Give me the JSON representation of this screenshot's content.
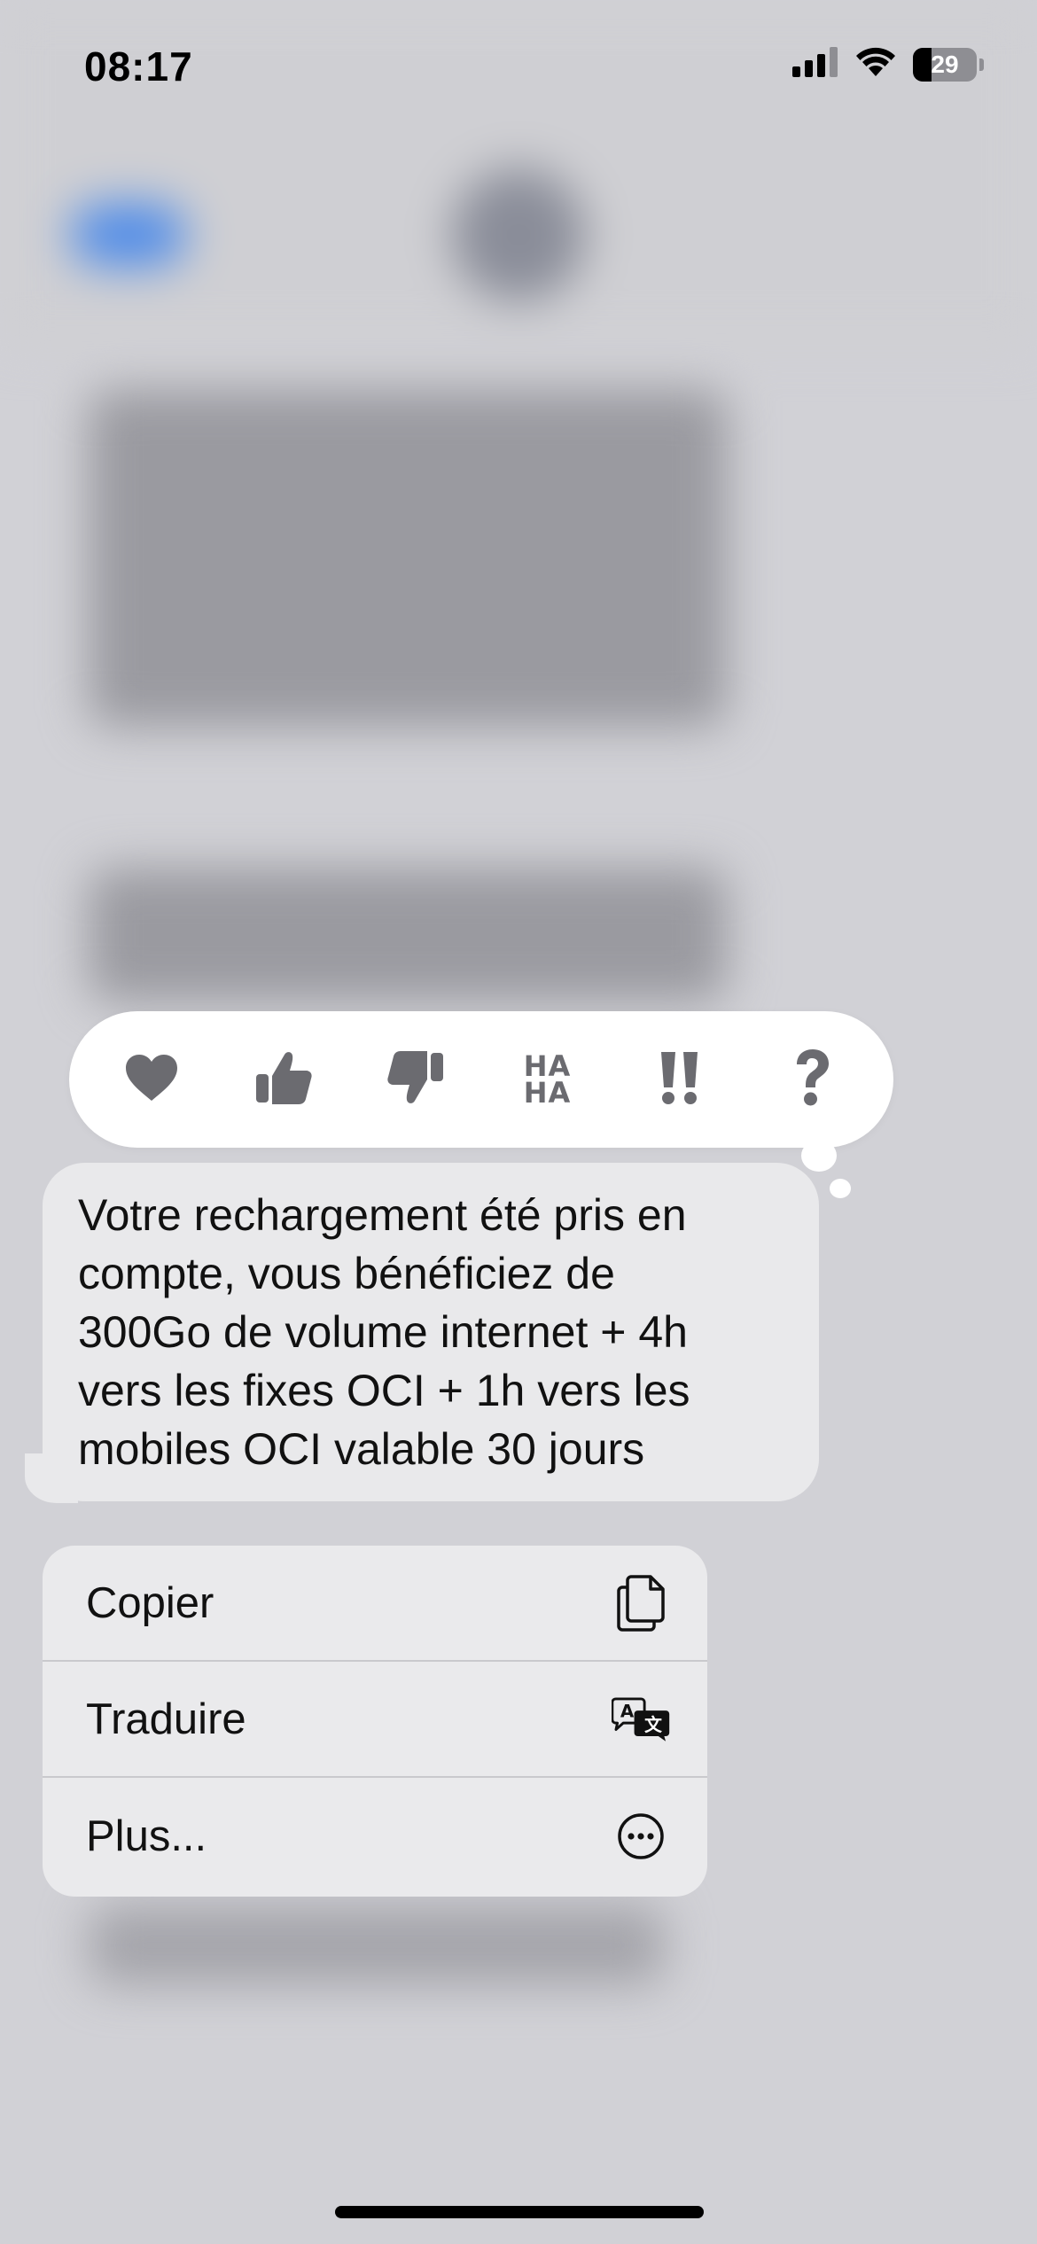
{
  "status_bar": {
    "time": "08:17",
    "battery": "29",
    "battery_level_percent": 29,
    "icons": [
      "cellular-signal-icon",
      "wifi-icon",
      "battery-icon"
    ]
  },
  "reactions": [
    {
      "name": "heart",
      "icon": "heart-icon"
    },
    {
      "name": "thumbs-up",
      "icon": "thumbs-up-icon"
    },
    {
      "name": "thumbs-down",
      "icon": "thumbs-down-icon"
    },
    {
      "name": "haha",
      "icon": "haha-icon",
      "line1": "HA",
      "line2": "HA"
    },
    {
      "name": "emphasize",
      "icon": "double-exclamation-icon"
    },
    {
      "name": "question",
      "icon": "question-mark-icon"
    }
  ],
  "message": {
    "lines": [
      "Votre rechargement été pris en",
      "compte, vous bénéficiez de",
      "300Go de volume internet + 4h",
      "vers les fixes OCI + 1h vers les",
      "mobiles OCI valable 30 jours"
    ]
  },
  "context_menu": {
    "items": [
      {
        "label": "Copier",
        "icon": "copy-icon"
      },
      {
        "label": "Traduire",
        "icon": "translate-icon"
      },
      {
        "label": "Plus...",
        "icon": "more-ellipsis-icon"
      }
    ]
  },
  "colors": {
    "backdrop": "#d1d1d6",
    "bubble": "#e9e9eb",
    "menu": "#eaeaec",
    "reaction_icon": "#6b6b70",
    "blurred_accent": "#4e8be8"
  }
}
